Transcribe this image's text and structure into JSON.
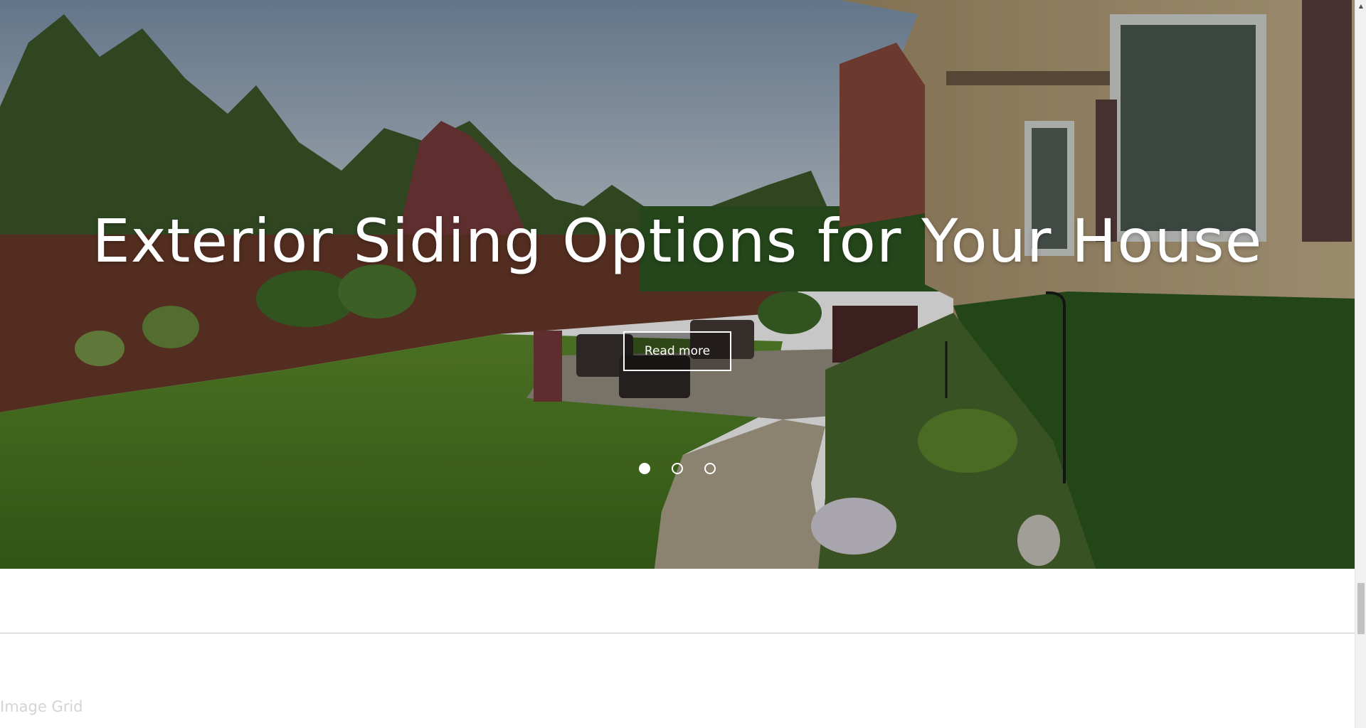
{
  "hero": {
    "title": "Exterior Siding Options for Your House",
    "button_label": "Read more",
    "slides": [
      {
        "active": true
      },
      {
        "active": false
      },
      {
        "active": false
      }
    ]
  },
  "section": {
    "label": "Image Grid"
  },
  "scrollbar": {
    "up_arrow": "▲"
  },
  "colors": {
    "hero_text": "#ffffff",
    "section_label": "#d4d4d4",
    "divider": "#c9c9c9"
  }
}
